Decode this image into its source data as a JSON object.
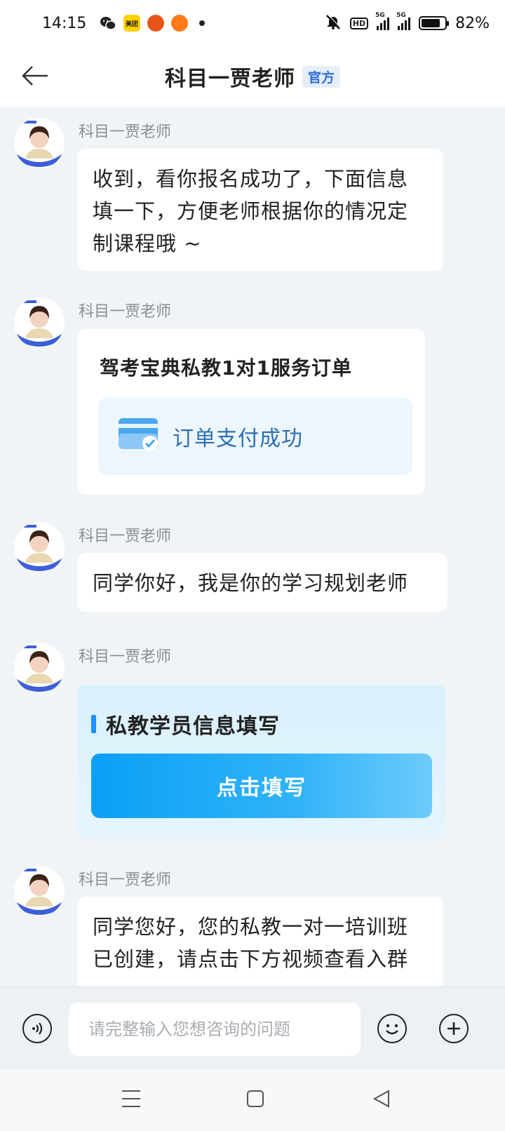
{
  "status": {
    "time": "14:15",
    "apps": [
      "wechat-icon",
      "meituan-icon",
      "app-orange-icon",
      "app-orange2-icon"
    ],
    "meituan_label": "美团",
    "hd": "HD",
    "sig_tag": "5G",
    "battery_pct": "82%",
    "battery_level": 0.82
  },
  "header": {
    "title": "科目一贾老师",
    "badge": "官方"
  },
  "messages": [
    {
      "sender": "科目一贾老师",
      "text": "收到，看你报名成功了，下面信息填一下，方便老师根据你的情况定制课程哦 ~"
    },
    {
      "sender": "科目一贾老师",
      "order_title": "驾考宝典私教1对1服务订单",
      "order_status": "订单支付成功"
    },
    {
      "sender": "科目一贾老师",
      "text": "同学你好，我是你的学习规划老师"
    },
    {
      "sender": "科目一贾老师",
      "form_title": "私教学员信息填写",
      "form_button": "点击填写"
    },
    {
      "sender": "科目一贾老师",
      "text": "同学您好，您的私教一对一培训班已创建，请点击下方视频查看入群"
    }
  ],
  "input": {
    "placeholder": "请完整输入您想咨询的问题"
  },
  "colors": {
    "accent": "#1e90ff",
    "order_status": "#2d6fb4",
    "background": "#f0f4f6"
  }
}
